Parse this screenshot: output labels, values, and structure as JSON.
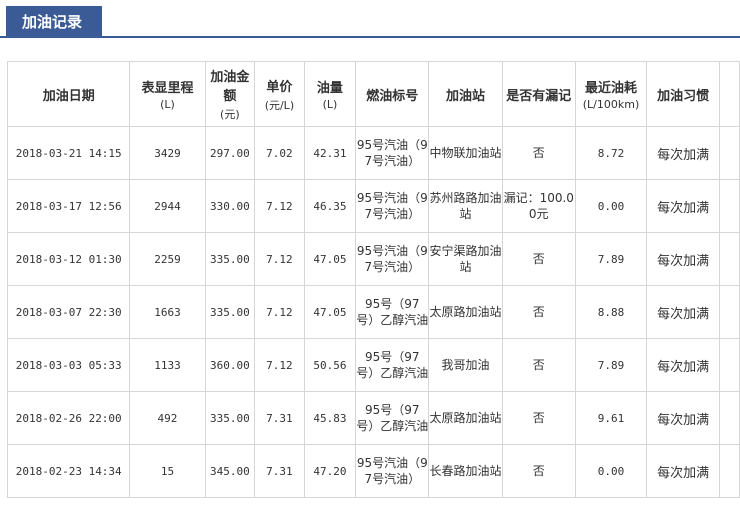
{
  "tab": {
    "label": "加油记录"
  },
  "table": {
    "headers": [
      {
        "label": "加油日期",
        "sub": ""
      },
      {
        "label": "表显里程",
        "sub": "(L)"
      },
      {
        "label": "加油金额",
        "sub": "(元)"
      },
      {
        "label": "单价",
        "sub": "(元/L)"
      },
      {
        "label": "油量",
        "sub": "(L)"
      },
      {
        "label": "燃油标号",
        "sub": ""
      },
      {
        "label": "加油站",
        "sub": ""
      },
      {
        "label": "是否有漏记",
        "sub": ""
      },
      {
        "label": "最近油耗",
        "sub": "(L/100km)"
      },
      {
        "label": "加油习惯",
        "sub": ""
      }
    ],
    "rows": [
      [
        "2018-03-21 14:15",
        "3429",
        "297.00",
        "7.02",
        "42.31",
        "95号汽油（97号汽油）",
        "中物联加油站",
        "否",
        "8.72",
        "每次加满"
      ],
      [
        "2018-03-17 12:56",
        "2944",
        "330.00",
        "7.12",
        "46.35",
        "95号汽油（97号汽油）",
        "苏州路路加油站",
        "漏记：100.00元",
        "0.00",
        "每次加满"
      ],
      [
        "2018-03-12 01:30",
        "2259",
        "335.00",
        "7.12",
        "47.05",
        "95号汽油（97号汽油）",
        "安宁渠路加油站",
        "否",
        "7.89",
        "每次加满"
      ],
      [
        "2018-03-07 22:30",
        "1663",
        "335.00",
        "7.12",
        "47.05",
        "95号（97号）乙醇汽油",
        "太原路加油站",
        "否",
        "8.88",
        "每次加满"
      ],
      [
        "2018-03-03 05:33",
        "1133",
        "360.00",
        "7.12",
        "50.56",
        "95号（97号）乙醇汽油",
        "我哥加油",
        "否",
        "7.89",
        "每次加满"
      ],
      [
        "2018-02-26 22:00",
        "492",
        "335.00",
        "7.31",
        "45.83",
        "95号（97号）乙醇汽油",
        "太原路加油站",
        "否",
        "9.61",
        "每次加满"
      ],
      [
        "2018-02-23 14:34",
        "15",
        "345.00",
        "7.31",
        "47.20",
        "95号汽油（97号汽油）",
        "长春路加油站",
        "否",
        "0.00",
        "每次加满"
      ]
    ]
  }
}
